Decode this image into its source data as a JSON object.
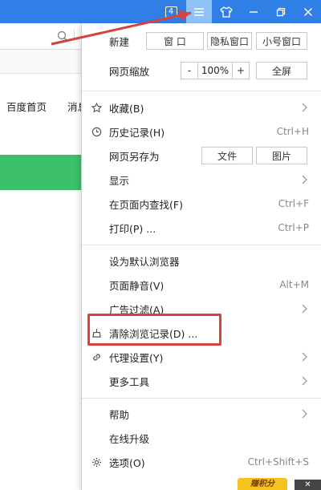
{
  "titlebar": {
    "tab_count": "4",
    "controls": [
      "menu-icon",
      "skin-icon",
      "minimize-icon",
      "restore-icon",
      "close-icon"
    ]
  },
  "page": {
    "nav_links": [
      "百度首页",
      "消息"
    ]
  },
  "menu": {
    "new": {
      "label": "新建",
      "buttons": [
        "窗 口",
        "隐私窗口",
        "小号窗口"
      ]
    },
    "zoom": {
      "label": "网页缩放",
      "minus": "-",
      "value": "100%",
      "plus": "+",
      "fullscreen": "全屏"
    },
    "favorites": "收藏(B)",
    "history": {
      "label": "历史记录(H)",
      "shortcut": "Ctrl+H"
    },
    "save_as": {
      "label": "网页另存为",
      "file": "文件",
      "image": "图片"
    },
    "display": "显示",
    "find": {
      "label": "在页面内查找(F)",
      "shortcut": "Ctrl+F"
    },
    "print": {
      "label": "打印(P) ...",
      "shortcut": "Ctrl+P"
    },
    "set_default": "设为默认浏览器",
    "mute": {
      "label": "页面静音(V)",
      "shortcut": "Alt+M"
    },
    "ad_filter": "广告过滤(A)",
    "clear_history": "清除浏览记录(D) ...",
    "proxy": "代理设置(Y)",
    "more_tools": "更多工具",
    "help": "帮助",
    "online_upgrade": "在线升级",
    "options": {
      "label": "选项(O)",
      "shortcut": "Ctrl+Shift+S"
    }
  },
  "badge": {
    "text": "赚积分"
  },
  "colors": {
    "titlebar": "#2f7fe6",
    "active_button": "#8fc0f6",
    "annotation_red": "#d9413c",
    "banner_green": "#3cc06a"
  }
}
